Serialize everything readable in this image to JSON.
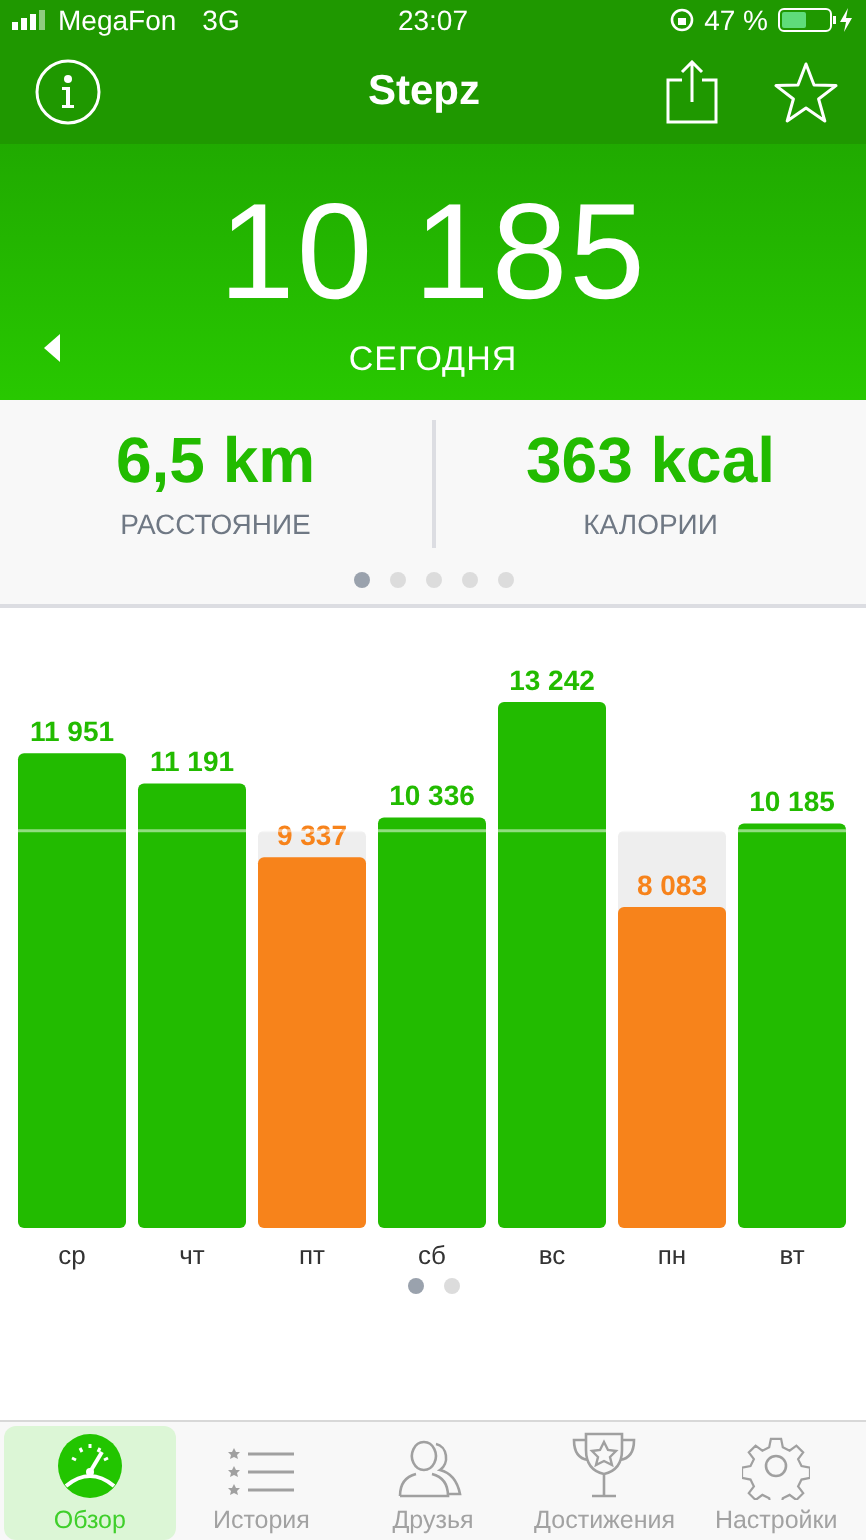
{
  "status_bar": {
    "carrier": "MegaFon",
    "network": "3G",
    "time": "23:07",
    "battery": "47 %"
  },
  "nav": {
    "title": "Stepz"
  },
  "hero": {
    "steps": "10 185",
    "period": "СЕГОДНЯ"
  },
  "stats": [
    {
      "value": "6,5 km",
      "label": "РАССТОЯНИЕ"
    },
    {
      "value": "363 kcal",
      "label": "КАЛОРИИ"
    }
  ],
  "stats_pages": [
    {
      "selected": true
    },
    {
      "selected": false
    },
    {
      "selected": false
    },
    {
      "selected": false
    },
    {
      "selected": false
    }
  ],
  "chart_data": {
    "type": "bar",
    "stacked": true,
    "data_labels": true,
    "categories": [
      "ср",
      "чт",
      "пт",
      "сб",
      "вс",
      "пн",
      "вт"
    ],
    "series": [
      {
        "color": "#22bb00",
        "values": [
          11951,
          11191,
          null,
          10336,
          13242,
          null,
          10185
        ]
      },
      {
        "color": "#f7831b",
        "values": [
          null,
          null,
          9337,
          null,
          null,
          8083,
          null
        ]
      }
    ]
  },
  "chart_pages": [
    {
      "selected": true
    },
    {
      "selected": false
    }
  ],
  "tabs": [
    {
      "kind": "overview",
      "label": "Обзор",
      "selected": true
    },
    {
      "kind": "history",
      "label": "История",
      "selected": false
    },
    {
      "kind": "friends",
      "label": "Друзья",
      "selected": false
    },
    {
      "kind": "achievements",
      "label": "Достижения",
      "selected": false
    },
    {
      "kind": "settings",
      "label": "Настройки",
      "selected": false
    }
  ]
}
